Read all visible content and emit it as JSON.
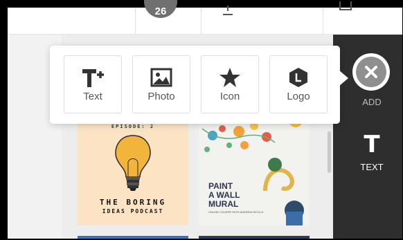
{
  "topbar": {
    "avatar_text": "26"
  },
  "add_menu": {
    "items": [
      {
        "label": "Text",
        "icon": "text-plus-icon"
      },
      {
        "label": "Photo",
        "icon": "photo-icon"
      },
      {
        "label": "Icon",
        "icon": "star-icon"
      },
      {
        "label": "Logo",
        "icon": "logo-hexagon-icon"
      }
    ]
  },
  "rail": {
    "add_label": "ADD",
    "text_label": "TEXT",
    "text_glyph": "T"
  },
  "cards": {
    "boring": {
      "episode": "EPISODE: 2",
      "title_line1": "THE BORING",
      "title_line2": "IDEAS PODCAST"
    },
    "mural": {
      "title": "PAINT\nA WALL\nMURAL",
      "subtitle": "ONLINE COURSE WITH ANDREW NICOLA"
    }
  },
  "colors": {
    "accent_dark": "#2e2e2e",
    "popup_bg": "#ffffff",
    "close_grey": "#8f8f8f"
  }
}
